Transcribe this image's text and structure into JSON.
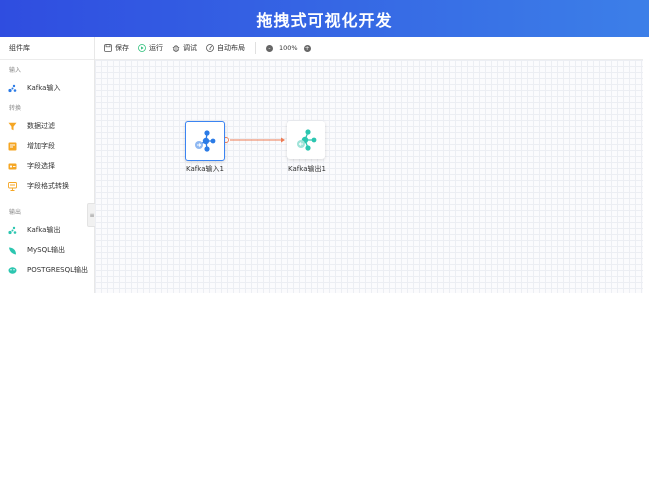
{
  "header": {
    "title": "拖拽式可视化开发"
  },
  "sidebar": {
    "title": "组件库",
    "groups": [
      {
        "label": "输入",
        "items": [
          {
            "label": "Kafka输入",
            "icon": "kafka-input-icon"
          }
        ]
      },
      {
        "label": "转换",
        "items": [
          {
            "label": "数据过滤",
            "icon": "filter-icon"
          },
          {
            "label": "增加字段",
            "icon": "add-field-icon"
          },
          {
            "label": "字段选择",
            "icon": "field-select-icon"
          },
          {
            "label": "字段格式转换",
            "icon": "field-format-icon"
          }
        ]
      },
      {
        "label": "输出",
        "items": [
          {
            "label": "Kafka输出",
            "icon": "kafka-output-icon"
          },
          {
            "label": "MySQL输出",
            "icon": "mysql-output-icon"
          },
          {
            "label": "POSTGRESQL输出",
            "icon": "postgresql-output-icon"
          }
        ]
      }
    ],
    "collapse_glyph": "≡"
  },
  "toolbar": {
    "save_label": "保存",
    "run_label": "运行",
    "debug_label": "调试",
    "autolayout_label": "自动布局",
    "zoom_out": "-",
    "zoom_value": "100%",
    "zoom_in": "+"
  },
  "canvas": {
    "nodes": [
      {
        "label": "Kafka输入1",
        "selected": true
      },
      {
        "label": "Kafka输出1",
        "selected": false
      }
    ],
    "edge_color": "#ee7b54"
  },
  "colors": {
    "header_start": "#2f4de0",
    "header_end": "#3c7fe8",
    "selection": "#3b84f2",
    "kafka_blue": "#2b7be6",
    "kafka_green": "#2cc6b0",
    "transform_orange": "#f5a623"
  }
}
